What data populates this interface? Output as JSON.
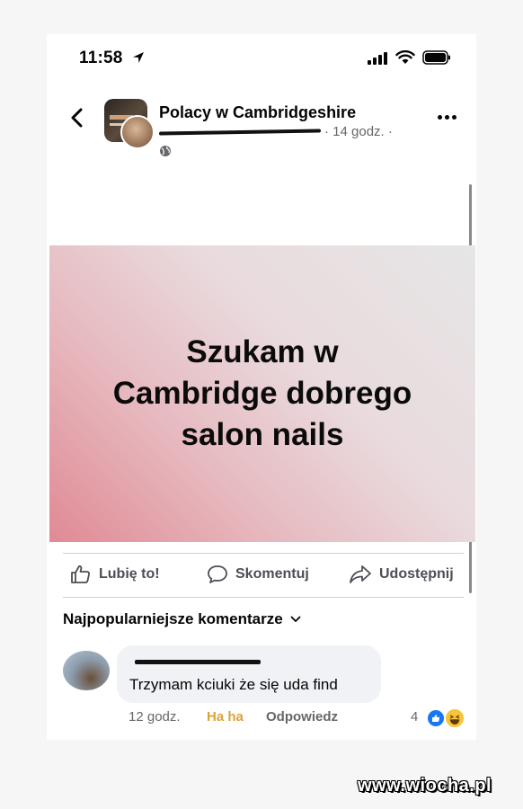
{
  "status_bar": {
    "time": "11:58"
  },
  "header": {
    "group_name": "Polacy w Cambridgeshire",
    "time_ago": "· 14 godz. ·"
  },
  "post": {
    "text": "Szukam w\nCambridge dobrego\nsalon nails"
  },
  "actions": {
    "like": "Lubię to!",
    "comment": "Skomentuj",
    "share": "Udostępnij"
  },
  "comments_section": {
    "sort_label": "Najpopularniejsze komentarze"
  },
  "comment": {
    "text": "Trzymam kciuki że się uda find",
    "time": "12 godz.",
    "haha": "Ha ha",
    "reply": "Odpowiedz",
    "reaction_count": "4"
  },
  "watermark": "www.wiocha.pl",
  "colors": {
    "accent": "#1877f2",
    "haha": "#d9a33a"
  },
  "icons": [
    "location-arrow-icon",
    "signal-icon",
    "wifi-icon",
    "battery-icon",
    "back-icon",
    "globe-icon",
    "more-icon",
    "like-icon",
    "comment-icon",
    "share-icon",
    "chevron-down-icon"
  ]
}
